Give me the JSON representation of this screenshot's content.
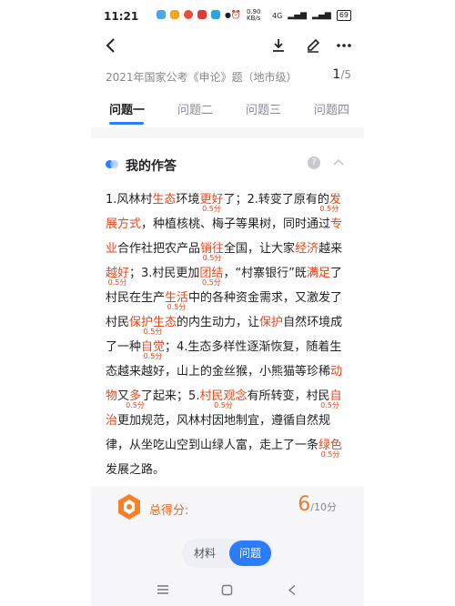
{
  "status": {
    "time": "11:21",
    "net_speed": "0.90 KB/s",
    "network": "4G",
    "battery": "69"
  },
  "header": {
    "exam_title": "2021年国家公考《申论》题（地市级）",
    "page_current": "1",
    "page_total": "/5"
  },
  "tabs": [
    "问题一",
    "问题二",
    "问题三",
    "问题四"
  ],
  "answer": {
    "title": "我的作答",
    "help_icon": "?",
    "segments": [
      "1.风林村",
      "生态",
      "环境",
      "更好",
      "了；2.转变了原有的",
      "发展方式",
      "，种植核桃、梅子等果树，同时通过",
      "专业",
      "合作社把农产品",
      "销往",
      "全国，让大家",
      "经济",
      "越来",
      "越好",
      "；3.村民更加",
      "团结",
      "，“村寨银行”既",
      "满足",
      "了村民在生产",
      "生活",
      "中的各种资金需求，又激发了村民",
      "保护生态",
      "的内生动力，让",
      "保护",
      "自然环境成了一种",
      "自觉",
      "；4.生态多样性逐渐恢复，随着生态越来越好，山上的金丝猴，小熊猫等珍稀",
      "动物",
      "又",
      "多",
      "了起来；5.",
      "村民观念",
      "有所转变，村民",
      "自治",
      "更加规范，风林村因地制宜，遵循自然规律，从坐吃山空到山绿人富，走上了一条",
      "绿色",
      "发展之路。"
    ],
    "score_tag": "0.5分"
  },
  "score": {
    "label": "总得分:",
    "value": "6",
    "total": "/10分"
  },
  "switch": {
    "material": "材料",
    "question": "问题"
  },
  "colors": {
    "accent": "#2b7cff",
    "highlight": "#e8471c",
    "score": "#f07a2b"
  }
}
